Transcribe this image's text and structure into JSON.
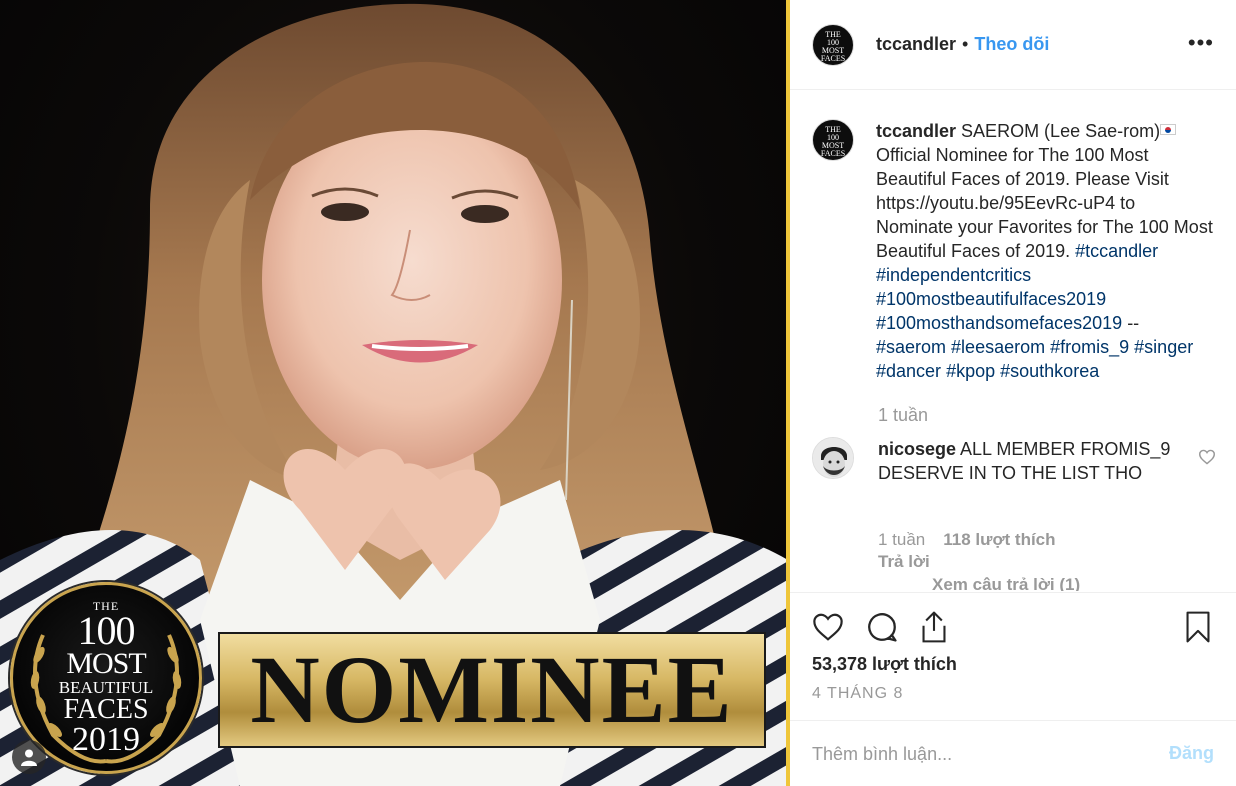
{
  "photo": {
    "seal": {
      "the": "THE",
      "hundred": "100",
      "most": "MOST",
      "beautiful": "BEAUTIFUL",
      "faces": "FACES",
      "year": "2019"
    },
    "banner": "NOMINEE"
  },
  "header": {
    "username": "tccandler",
    "separator": "•",
    "follow_label": "Theo dõi",
    "more_label": "•••",
    "avatar_lines": [
      "THE",
      "100",
      "MOST",
      "FACES",
      "2019"
    ]
  },
  "caption": {
    "username": "tccandler",
    "text_1": " SAEROM (Lee Sae-rom)",
    "text_2": " Official Nominee for The 100 Most Beautiful Faces of 2019. Please Visit https://youtu.be/95EevRc-uP4 to Nominate your Favorites for The 100 Most Beautiful Faces of 2019. ",
    "hashtags_1": [
      "#tccandler",
      "#independentcritics",
      "#100mostbeautifulfaces2019",
      "#100mosthandsomefaces2019"
    ],
    "dashes": " -- ",
    "hashtags_2": [
      "#saerom",
      "#leesaerom",
      "#fromis_9",
      "#singer",
      "#dancer",
      "#kpop",
      "#southkorea"
    ],
    "time": "1 tuần"
  },
  "comment": {
    "username": "nicosege",
    "text": " ALL MEMBER FROMIS_9 DESERVE IN TO THE LIST THO",
    "time": "1 tuần",
    "likes": "118 lượt thích",
    "reply_label": "Trả lời",
    "view_replies": "Xem câu trả lời (1)"
  },
  "actions": {
    "likes_count": "53,378 lượt thích",
    "date": "4 THÁNG 8"
  },
  "add_comment": {
    "placeholder": "Thêm bình luận...",
    "post_label": "Đăng"
  },
  "colors": {
    "link": "#3897f0",
    "hashtag": "#003569",
    "muted": "#999999",
    "post_disabled": "#b2dffc"
  }
}
